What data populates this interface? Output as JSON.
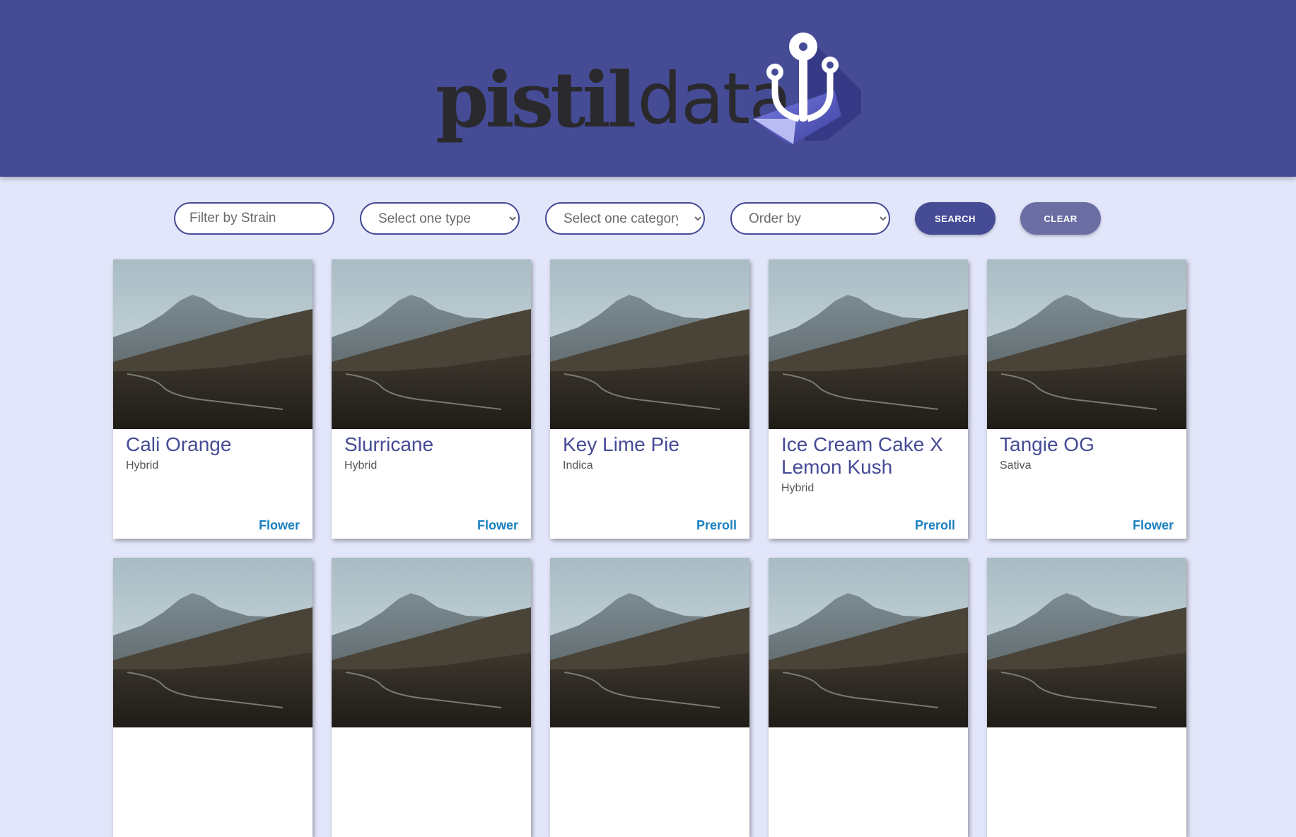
{
  "brand": {
    "part1": "pistil",
    "part2": "data"
  },
  "filters": {
    "strain_placeholder": "Filter by Strain",
    "type_selected": "Select one type",
    "category_selected": "Select one category",
    "order_selected": "Order by",
    "search_label": "SEARCH",
    "clear_label": "CLEAR"
  },
  "colors": {
    "header": "#464b96",
    "background": "#e3e6fa",
    "title": "#464b96",
    "category": "#1a7fbf",
    "clear_button": "#6b6ea3"
  },
  "cards": [
    {
      "name": "Cali Orange",
      "type": "Hybrid",
      "category": "Flower"
    },
    {
      "name": "Slurricane",
      "type": "Hybrid",
      "category": "Flower"
    },
    {
      "name": "Key Lime Pie",
      "type": "Indica",
      "category": "Preroll"
    },
    {
      "name": "Ice Cream Cake X Lemon Kush",
      "type": "Hybrid",
      "category": "Preroll"
    },
    {
      "name": "Tangie OG",
      "type": "Sativa",
      "category": "Flower"
    }
  ],
  "card_image": "mountain-landscape-photo"
}
